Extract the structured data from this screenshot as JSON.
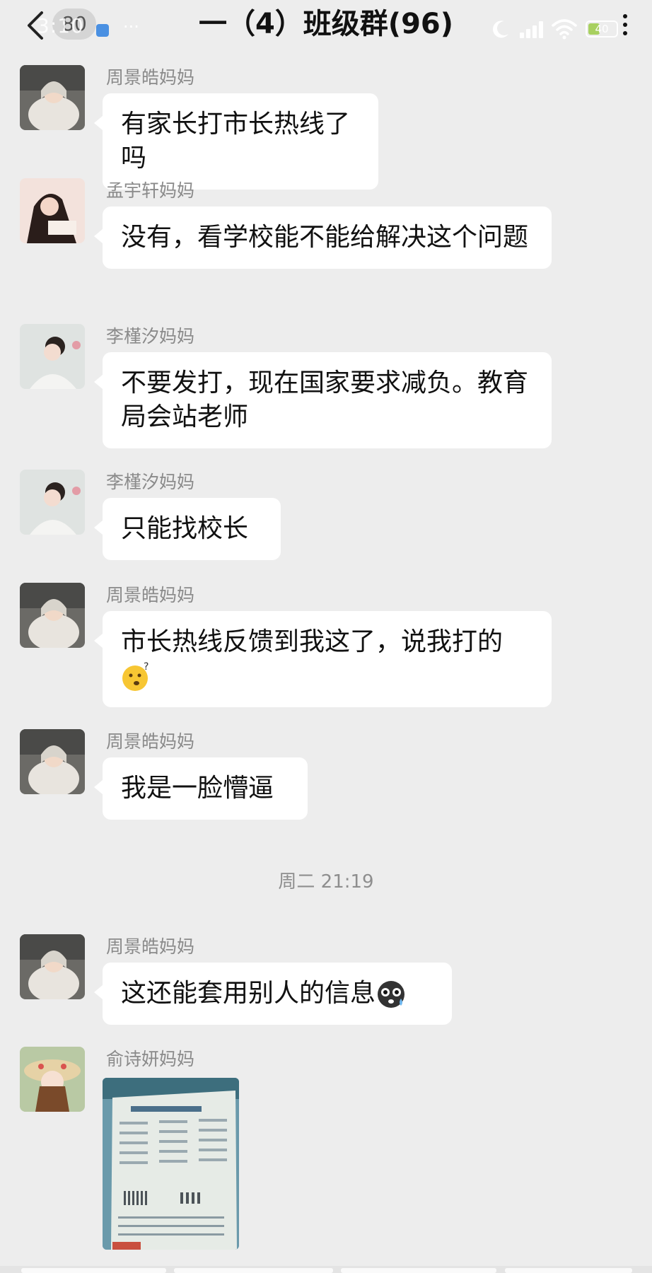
{
  "header": {
    "title": "一（4）班级群(96)",
    "back_badge": "80",
    "status_time": "3:10",
    "status_more": "···",
    "battery": "40",
    "icons": [
      "back-icon",
      "moon-icon",
      "signal-icon",
      "wifi-icon",
      "battery-icon",
      "more-icon"
    ]
  },
  "messages": [
    {
      "sender": "周景皓妈妈",
      "text": "有家长打市长热线了吗",
      "avatar": "avatar-zhou"
    },
    {
      "sender": "孟宇轩妈妈",
      "text": "没有，看学校能不能给解决这个问题",
      "avatar": "avatar-meng"
    },
    {
      "sender": "李槿汐妈妈",
      "text": "不要发打，现在国家要求减负。教育局会站老师",
      "avatar": "avatar-li"
    },
    {
      "sender": "李槿汐妈妈",
      "text": "只能找校长",
      "avatar": "avatar-li"
    },
    {
      "sender": "周景皓妈妈",
      "text": "市长热线反馈到我这了，说我打的",
      "emoji": "confused-face-emoji",
      "avatar": "avatar-zhou"
    },
    {
      "sender": "周景皓妈妈",
      "text": "我是一脸懵逼",
      "avatar": "avatar-zhou"
    }
  ],
  "timestamp": "周二 21:19",
  "messages_after": [
    {
      "sender": "周景皓妈妈",
      "text": "这还能套用别人的信息",
      "emoji": "shocked-face-emoji",
      "avatar": "avatar-zhou"
    },
    {
      "sender": "俞诗妍妈妈",
      "image": "photo of math workbook page",
      "avatar": "avatar-yu"
    }
  ],
  "colors": {
    "background": "#ededed",
    "bubble": "#ffffff",
    "sender_text": "#8a8a8a"
  }
}
